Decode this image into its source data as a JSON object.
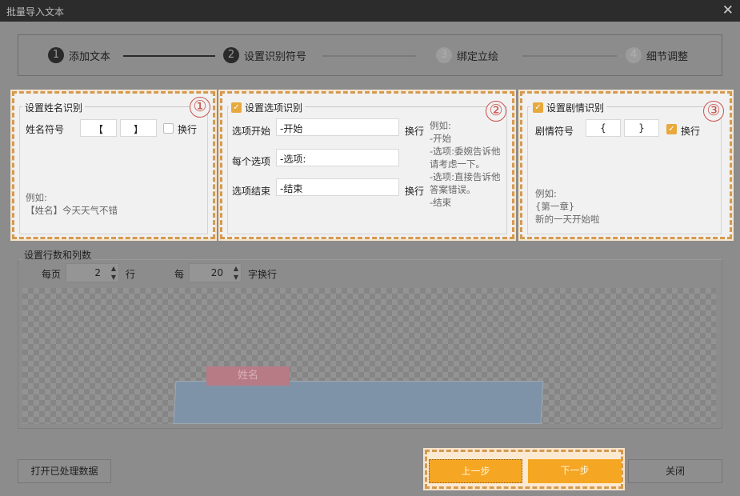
{
  "window": {
    "title": "批量导入文本",
    "close_icon": "close-icon"
  },
  "steps": [
    {
      "num": "1",
      "label": "添加文本",
      "active": true
    },
    {
      "num": "2",
      "label": "设置识别符号",
      "active": true
    },
    {
      "num": "3",
      "label": "绑定立绘",
      "active": false
    },
    {
      "num": "4",
      "label": "细节调整",
      "active": false
    }
  ],
  "name_panel": {
    "badge": "①",
    "title": "设置姓名识别",
    "symbol_label": "姓名符号",
    "open": "【",
    "close": "】",
    "newline_label": "换行",
    "newline_checked": false,
    "example": "例如:\n【姓名】今天天气不错"
  },
  "option_panel": {
    "badge": "②",
    "title": "设置选项识别",
    "enabled": true,
    "start_label": "选项开始",
    "start_value": "-开始",
    "start_newline": "换行",
    "each_label": "每个选项",
    "each_value": "-选项:",
    "end_label": "选项结束",
    "end_value": "-结束",
    "end_newline": "换行",
    "example": "例如:\n-开始\n-选项:委婉告诉他\n请考虑一下。\n-选项:直接告诉他\n答案错误。\n-结束"
  },
  "plot_panel": {
    "badge": "③",
    "title": "设置剧情识别",
    "enabled": true,
    "symbol_label": "剧情符号",
    "open": "{",
    "close": "}",
    "newline_label": "换行",
    "newline_checked": true,
    "example": "例如:\n{第一章}\n新的一天开始啦"
  },
  "rows": {
    "title": "设置行数和列数",
    "per_page_label": "每页",
    "per_page_value": "2",
    "rows_unit": "行",
    "per_label": "每",
    "per_value": "20",
    "chars_unit": "字换行"
  },
  "preview": {
    "name_tag": "姓名"
  },
  "buttons": {
    "open_processed": "打开已处理数据",
    "prev": "上一步",
    "next": "下一步",
    "close": "关闭"
  },
  "colors": {
    "accent": "#f5a623",
    "highlight_border": "#d59a4f",
    "badge": "#c9544f"
  }
}
